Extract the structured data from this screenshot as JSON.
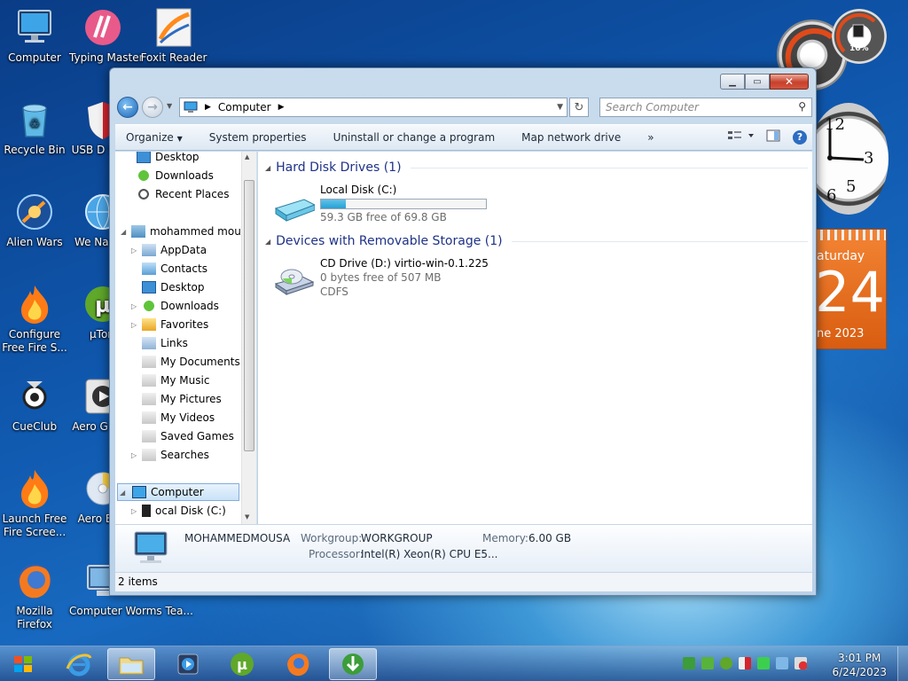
{
  "desktop": {
    "icons": [
      {
        "label": "Computer",
        "kind": "monitor"
      },
      {
        "label": "Recycle Bin",
        "kind": "recycle"
      },
      {
        "label": "Alien Wars",
        "kind": "alien"
      },
      {
        "label": "Configure Free Fire S...",
        "kind": "flame"
      },
      {
        "label": "CueClub",
        "kind": "cue"
      },
      {
        "label": "Launch Free Fire Scree...",
        "kind": "flame"
      },
      {
        "label": "Mozilla Firefox",
        "kind": "firefox"
      }
    ],
    "icons2": [
      {
        "label": "Typing Master",
        "kind": "typing"
      },
      {
        "label": "USB D Secu",
        "kind": "shield"
      },
      {
        "label": "We Naviga",
        "kind": "globe"
      },
      {
        "label": "µTorr",
        "kind": "utorrent"
      },
      {
        "label": "Aero G Play",
        "kind": "media"
      },
      {
        "label": "Aero Burr",
        "kind": "disc"
      },
      {
        "label": "Computer Worms Tea...",
        "kind": "worms"
      }
    ],
    "icons3": [
      {
        "label": "Foxit Reader",
        "kind": "foxit"
      }
    ]
  },
  "gadgets": {
    "cpu_percent": "16%",
    "calendar_day": "aturday",
    "calendar_date": "24",
    "calendar_month": "ne 2023"
  },
  "window": {
    "address": {
      "location": "Computer"
    },
    "search_placeholder": "Search Computer",
    "toolbar": {
      "organize": "Organize",
      "system_properties": "System properties",
      "uninstall": "Uninstall or change a program",
      "map_drive": "Map network drive",
      "more": "»"
    },
    "nav_tree": [
      {
        "label": "Desktop",
        "kind": "desktop"
      },
      {
        "label": "Downloads",
        "kind": "downloads"
      },
      {
        "label": "Recent Places",
        "kind": "recent"
      },
      {
        "label": "mohammed mous",
        "kind": "user"
      },
      {
        "label": "AppData",
        "kind": "folder"
      },
      {
        "label": "Contacts",
        "kind": "contacts"
      },
      {
        "label": "Desktop",
        "kind": "desktop"
      },
      {
        "label": "Downloads",
        "kind": "downloads"
      },
      {
        "label": "Favorites",
        "kind": "favorites"
      },
      {
        "label": "Links",
        "kind": "links"
      },
      {
        "label": "My Documents",
        "kind": "docs"
      },
      {
        "label": "My Music",
        "kind": "music"
      },
      {
        "label": "My Pictures",
        "kind": "pictures"
      },
      {
        "label": "My Videos",
        "kind": "videos"
      },
      {
        "label": "Saved Games",
        "kind": "games"
      },
      {
        "label": "Searches",
        "kind": "searches"
      },
      {
        "label": "Computer",
        "kind": "computer"
      },
      {
        "label": "ocal Disk (C:)",
        "kind": "disk"
      }
    ],
    "groups": {
      "hdd": "Hard Disk Drives (1)",
      "removable": "Devices with Removable Storage (1)"
    },
    "drives": {
      "c": {
        "name": "Local Disk (C:)",
        "free": "59.3 GB free of 69.8 GB",
        "used_fraction": 0.15
      },
      "d": {
        "name": "CD Drive (D:) virtio-win-0.1.225",
        "free": "0 bytes free of 507 MB",
        "fs": "CDFS"
      }
    },
    "details": {
      "computer_name": "MOHAMMEDMOUSA",
      "workgroup_label": "Workgroup:",
      "workgroup": "WORKGROUP",
      "memory_label": "Memory:",
      "memory": "6.00 GB",
      "processor_label": "Processor:",
      "processor": "Intel(R) Xeon(R) CPU E5..."
    },
    "status": "2 items"
  },
  "taskbar": {
    "time": "3:01 PM",
    "date": "6/24/2023"
  }
}
